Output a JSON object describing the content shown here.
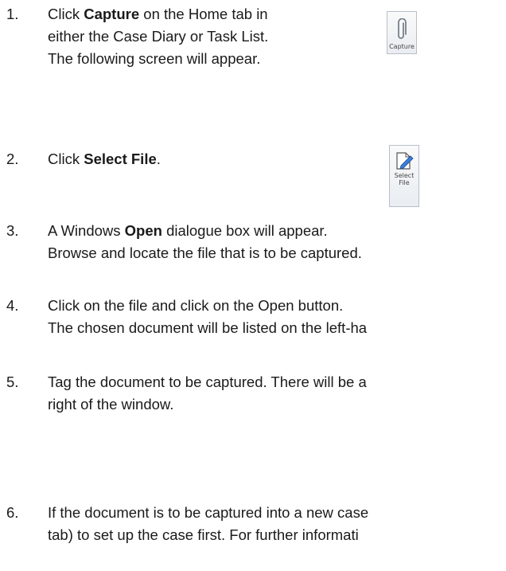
{
  "steps": [
    {
      "number": "1.",
      "lines": [
        [
          "Click ",
          "Capture",
          " on the Home tab in"
        ],
        [
          "either the Case Diary or Task List."
        ],
        [
          "The following screen will appear."
        ]
      ]
    },
    {
      "number": "2.",
      "lines": [
        [
          "Click ",
          "Select File",
          "."
        ]
      ]
    },
    {
      "number": "3.",
      "lines": [
        [
          "A Windows ",
          "Open",
          " dialogue box will appear."
        ],
        [
          "Browse and locate the file that is to be captured."
        ]
      ]
    },
    {
      "number": "4.",
      "lines": [
        [
          "Click on the file and click on the Open button."
        ],
        [
          "The chosen document will be listed on the left-ha"
        ]
      ]
    },
    {
      "number": "5.",
      "lines": [
        [
          "Tag the document to be captured. There will be a"
        ],
        [
          "right of the window."
        ]
      ]
    },
    {
      "number": "6.",
      "lines": [
        [
          "If the document is to be captured into a new case"
        ],
        [
          "tab) to set up the case first. For further informati"
        ]
      ]
    }
  ],
  "capture_button": {
    "label": "Capture",
    "icon": "paperclip-icon"
  },
  "select_file_button": {
    "label_line1": "Select",
    "label_line2": "File",
    "icon": "pencil-document-icon"
  }
}
